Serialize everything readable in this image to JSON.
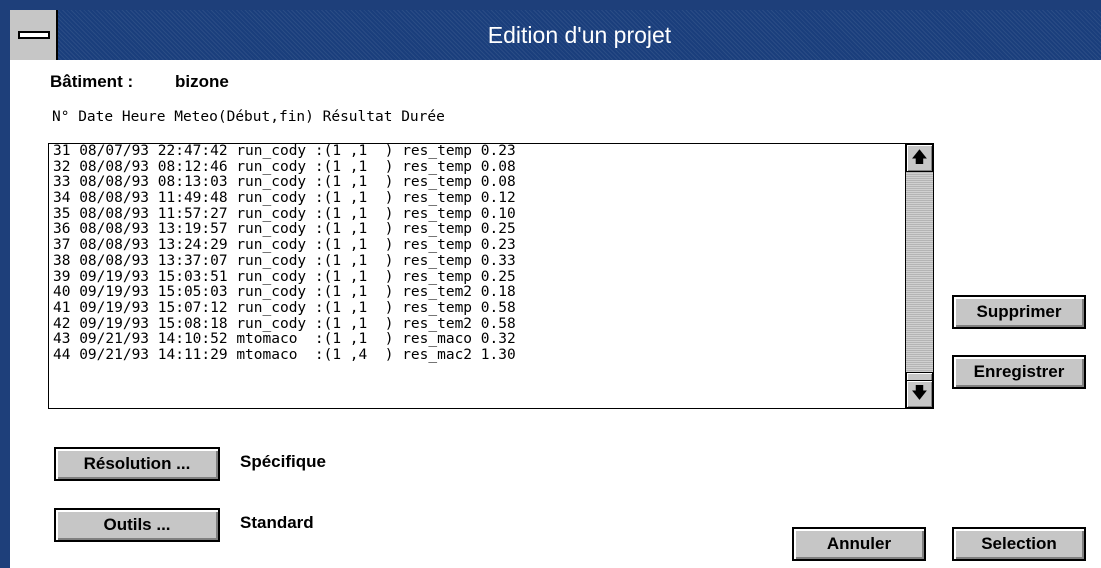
{
  "window": {
    "title": "Edition d'un projet"
  },
  "building": {
    "label": "Bâtiment :",
    "value": "bizone"
  },
  "list": {
    "header": "N° Date     Heure    Meteo(Début,fin)  Résultat Durée",
    "rows": [
      "31 08/07/93 22:47:42 run_cody :(1 ,1  ) res_temp 0.23",
      "32 08/08/93 08:12:46 run_cody :(1 ,1  ) res_temp 0.08",
      "33 08/08/93 08:13:03 run_cody :(1 ,1  ) res_temp 0.08",
      "34 08/08/93 11:49:48 run_cody :(1 ,1  ) res_temp 0.12",
      "35 08/08/93 11:57:27 run_cody :(1 ,1  ) res_temp 0.10",
      "36 08/08/93 13:19:57 run_cody :(1 ,1  ) res_temp 0.25",
      "37 08/08/93 13:24:29 run_cody :(1 ,1  ) res_temp 0.23",
      "38 08/08/93 13:37:07 run_cody :(1 ,1  ) res_temp 0.33",
      "39 09/19/93 15:03:51 run_cody :(1 ,1  ) res_temp 0.25",
      "40 09/19/93 15:05:03 run_cody :(1 ,1  ) res_tem2 0.18",
      "41 09/19/93 15:07:12 run_cody :(1 ,1  ) res_temp 0.58",
      "42 09/19/93 15:08:18 run_cody :(1 ,1  ) res_tem2 0.58",
      "43 09/21/93 14:10:52 mtomaco  :(1 ,1  ) res_maco 0.32",
      "44 09/21/93 14:11:29 mtomaco  :(1 ,4  ) res_mac2 1.30"
    ]
  },
  "scrollbar": {
    "up_glyph": "🡅",
    "down_glyph": "🡇"
  },
  "buttons": {
    "delete": "Supprimer",
    "save": "Enregistrer",
    "resolution": "Résolution ...",
    "tools": "Outils ...",
    "cancel": "Annuler",
    "select": "Selection"
  },
  "settings": {
    "resolution_value": "Spécifique",
    "tools_value": "Standard"
  },
  "colors": {
    "titlebar": "#1a3e7c",
    "button_face": "#c6c6c6"
  }
}
